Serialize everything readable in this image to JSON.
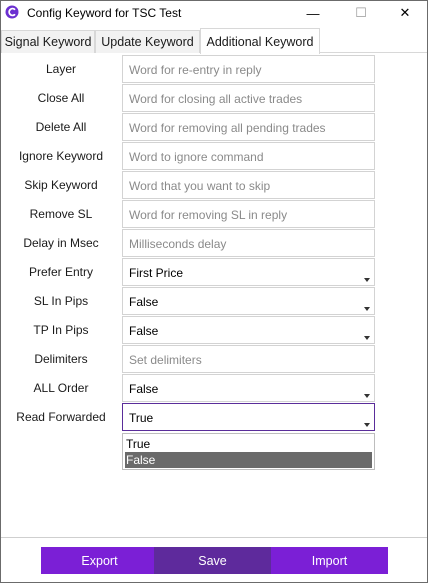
{
  "window": {
    "title": "Config Keyword for TSC Test",
    "minimize_glyph": "—",
    "maximize_glyph": "☐",
    "close_glyph": "✕",
    "app_icon": "tsc-logo-icon"
  },
  "tabs": [
    {
      "label": "Signal Keyword",
      "active": false
    },
    {
      "label": "Update Keyword",
      "active": false
    },
    {
      "label": "Additional Keyword",
      "active": true
    }
  ],
  "fields": [
    {
      "label": "Layer",
      "type": "input",
      "placeholder": "Word for re-entry in reply"
    },
    {
      "label": "Close All",
      "type": "input",
      "placeholder": "Word for closing all active trades"
    },
    {
      "label": "Delete All",
      "type": "input",
      "placeholder": "Word for removing all pending trades"
    },
    {
      "label": "Ignore Keyword",
      "type": "input",
      "placeholder": "Word to ignore command"
    },
    {
      "label": "Skip Keyword",
      "type": "input",
      "placeholder": "Word that you want to skip"
    },
    {
      "label": "Remove SL",
      "type": "input",
      "placeholder": "Word for removing SL in reply"
    },
    {
      "label": "Delay in Msec",
      "type": "input",
      "placeholder": "Milliseconds delay"
    },
    {
      "label": "Prefer Entry",
      "type": "select",
      "value": "First Price"
    },
    {
      "label": "SL In Pips",
      "type": "select",
      "value": "False"
    },
    {
      "label": "TP In Pips",
      "type": "select",
      "value": "False"
    },
    {
      "label": "Delimiters",
      "type": "input",
      "placeholder": "Set delimiters"
    },
    {
      "label": "ALL Order",
      "type": "select",
      "value": "False"
    },
    {
      "label": "Read Forwarded",
      "type": "select",
      "value": "True",
      "open": true
    }
  ],
  "dropdown": {
    "options": [
      "True",
      "False"
    ],
    "highlighted": "False"
  },
  "buttons": {
    "export": "Export",
    "save": "Save",
    "import": "Import"
  },
  "colors": {
    "button_accent": "#7b1fd6",
    "save_button": "#5e2a9c",
    "focus_border": "#5a2d9a",
    "highlight": "#6a6a6a"
  }
}
